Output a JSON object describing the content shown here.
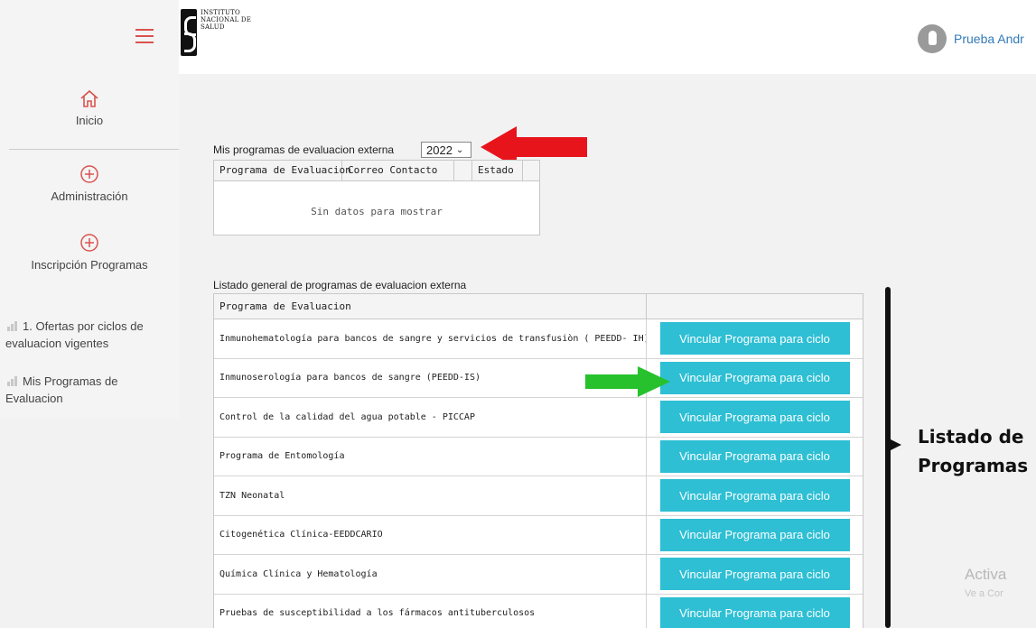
{
  "header": {
    "logo_lines": [
      "INSTITUTO",
      "NACIONAL DE",
      "SALUD"
    ],
    "user_name": "Prueba Andr"
  },
  "sidebar": {
    "items": [
      {
        "label": "Inicio",
        "icon": "home-icon"
      },
      {
        "label": "Administración",
        "icon": "plus-circle-icon"
      },
      {
        "label": "Inscripción Programas",
        "icon": "plus-circle-icon"
      }
    ],
    "subitems": [
      {
        "line1": "1. Ofertas por ciclos de",
        "line2": "evaluacion vigentes",
        "icon": "bar-chart-icon"
      },
      {
        "line1": "Mis Programas de",
        "line2": "Evaluacion",
        "icon": "bar-chart-icon"
      }
    ]
  },
  "my_programs": {
    "title": "Mis programas de evaluacion externa",
    "year": "2022",
    "columns": [
      "Programa de Evaluacion",
      "Correo Contacto",
      "",
      "Estado"
    ],
    "empty_message": "Sin datos para mostrar"
  },
  "general_list": {
    "title": "Listado general de programas de evaluacion externa",
    "column": "Programa de Evaluacion",
    "button_label": "Vincular Programa para ciclo",
    "rows": [
      "Inmunohematología para bancos de sangre y servicios de transfusiòn ( PEEDD- IH)",
      "Inmunoserología para bancos de sangre (PEEDD-IS)",
      "Control de la calidad del agua potable - PICCAP",
      "Programa de Entomología",
      "TZN Neonatal",
      "Citogenética Clínica-EEDDCARIO",
      "Química Clínica y Hematología",
      "Pruebas de susceptibilidad a los fármacos antituberculosos"
    ]
  },
  "annotation": {
    "line1": "Listado de",
    "line2": "Programas",
    "red_arrow_color": "#e8141c",
    "green_arrow_color": "#27c12e"
  },
  "watermark": {
    "line1": "Activa",
    "line2": "Ve a Cor"
  }
}
